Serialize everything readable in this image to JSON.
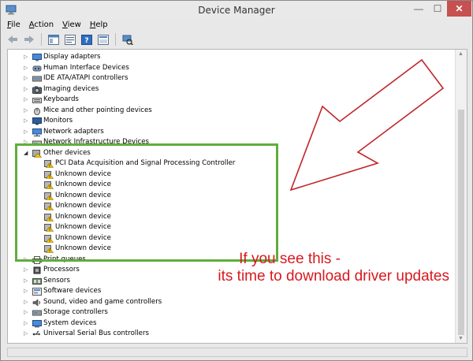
{
  "window": {
    "title": "Device Manager",
    "close_glyph": "✕",
    "min_glyph": "—",
    "max_glyph": "☐"
  },
  "menu": [
    {
      "label": "File",
      "key": "F",
      "rest": "ile"
    },
    {
      "label": "Action",
      "key": "A",
      "rest": "ction"
    },
    {
      "label": "View",
      "key": "V",
      "rest": "iew"
    },
    {
      "label": "Help",
      "key": "H",
      "rest": "elp"
    }
  ],
  "toolbar": {
    "buttons": [
      "back-arrow-icon",
      "forward-arrow-icon",
      "properties-icon",
      "help-icon",
      "update-icon",
      "scan-hardware-icon"
    ]
  },
  "tree": {
    "categories_above": [
      {
        "label": "Display adapters",
        "icon": "display-adapter-icon"
      },
      {
        "label": "Human Interface Devices",
        "icon": "hid-icon"
      },
      {
        "label": "IDE ATA/ATAPI controllers",
        "icon": "ide-controller-icon"
      },
      {
        "label": "Imaging devices",
        "icon": "imaging-device-icon"
      },
      {
        "label": "Keyboards",
        "icon": "keyboard-icon"
      },
      {
        "label": "Mice and other pointing devices",
        "icon": "mouse-icon"
      },
      {
        "label": "Monitors",
        "icon": "monitor-icon"
      },
      {
        "label": "Network adapters",
        "icon": "network-adapter-icon"
      },
      {
        "label": "Network Infrastructure Devices",
        "icon": "network-infrastructure-icon"
      }
    ],
    "other_devices": {
      "label": "Other devices",
      "children": [
        "PCI Data Acquisition and Signal Processing Controller",
        "Unknown device",
        "Unknown device",
        "Unknown device",
        "Unknown device",
        "Unknown device",
        "Unknown device",
        "Unknown device",
        "Unknown device"
      ]
    },
    "categories_below": [
      {
        "label": "Print queues",
        "icon": "printer-icon"
      },
      {
        "label": "Processors",
        "icon": "processor-icon"
      },
      {
        "label": "Sensors",
        "icon": "sensor-icon"
      },
      {
        "label": "Software devices",
        "icon": "software-device-icon"
      },
      {
        "label": "Sound, video and game controllers",
        "icon": "sound-icon"
      },
      {
        "label": "Storage controllers",
        "icon": "storage-controller-icon"
      },
      {
        "label": "System devices",
        "icon": "system-device-icon"
      },
      {
        "label": "Universal Serial Bus controllers",
        "icon": "usb-icon"
      }
    ]
  },
  "annotation": {
    "line1": "If you see this -",
    "line2": "its time to download driver updates",
    "text_color": "#d7191f",
    "arrow_color": "#c0262c",
    "box_color": "#5fae3c"
  }
}
